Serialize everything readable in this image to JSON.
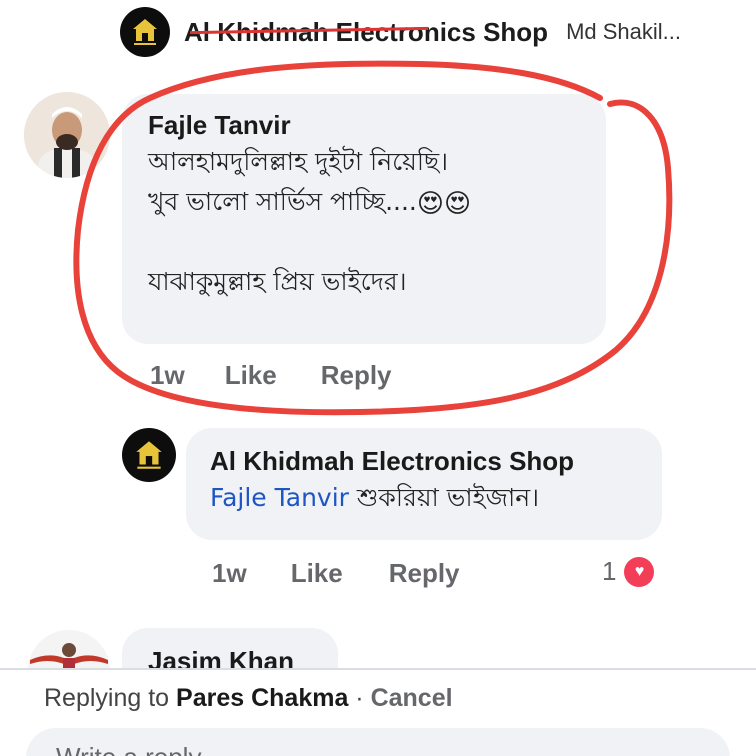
{
  "thread_header": {
    "page_name": "Al Khidmah Electronics Shop",
    "reply_preview": "Md Shakil..."
  },
  "comments": [
    {
      "author": "Fajle Tanvir",
      "line1": "আলহামদুলিল্লাহ দুইটা নিয়েছি।",
      "line2": "খুব ভালো সার্ভিস পাচ্ছি....",
      "emoji": "😍😍",
      "line3": "যাঝাকুমুল্লাহ প্রিয় ভাইদের।",
      "time": "1w",
      "like_label": "Like",
      "reply_label": "Reply"
    },
    {
      "author": "Al Khidmah Electronics Shop",
      "tagged": "Fajle Tanvir",
      "text": "শুকরিয়া ভাইজান।",
      "time": "1w",
      "like_label": "Like",
      "reply_label": "Reply",
      "reaction_count": "1"
    },
    {
      "author": "Jasim Khan"
    }
  ],
  "reply_bar": {
    "prefix": "Replying to",
    "target": "Pares Chakma",
    "separator": " · ",
    "cancel_label": "Cancel",
    "input_placeholder": "Write a reply..."
  },
  "colors": {
    "annotation": "#e8423b",
    "bubble": "#f0f2f5",
    "link": "#1d56c4",
    "reaction": "#f33e58"
  }
}
